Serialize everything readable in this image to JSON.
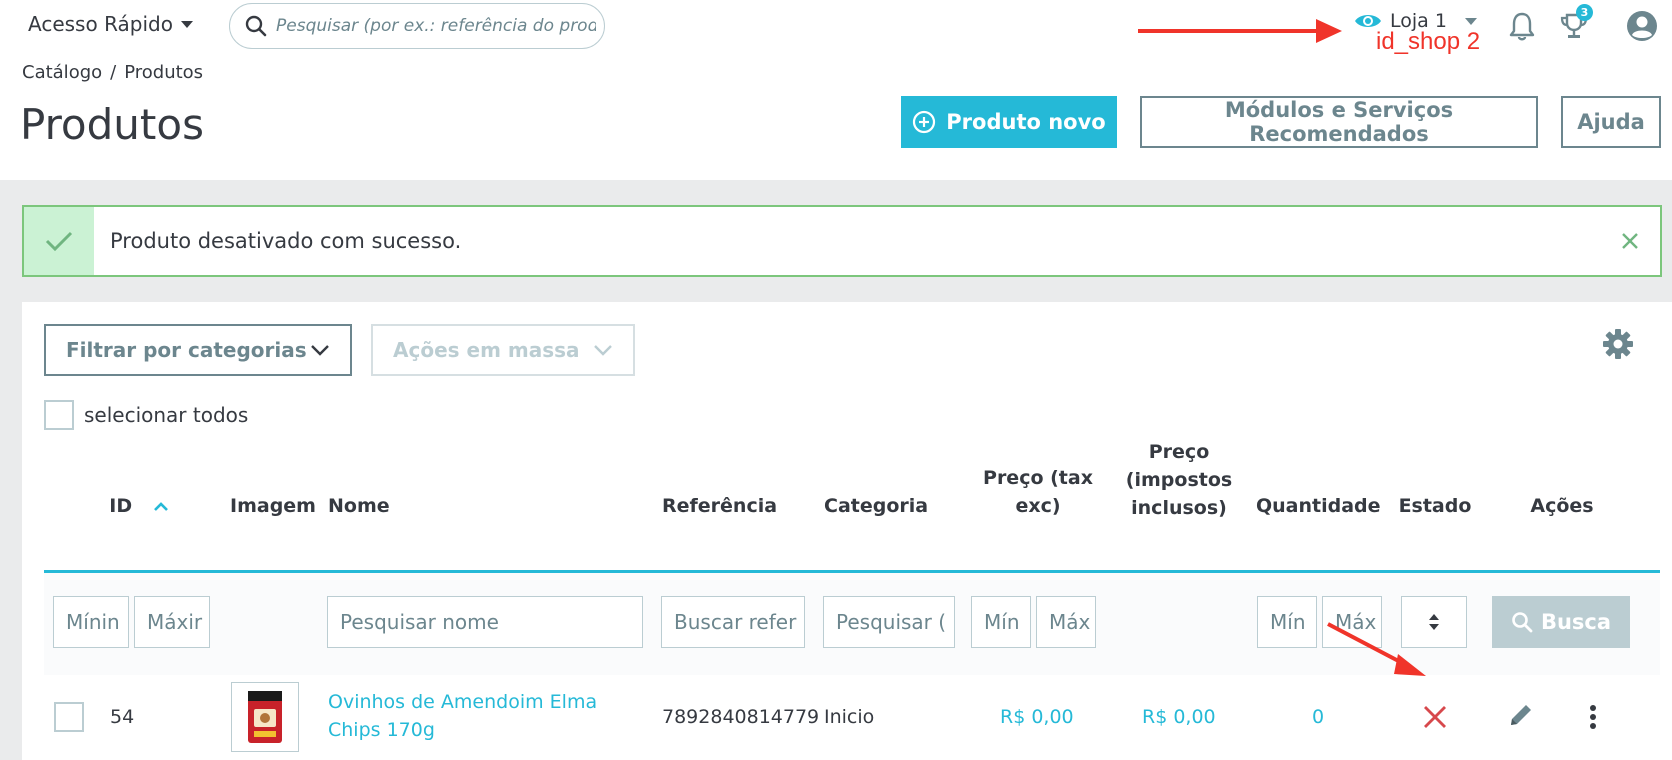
{
  "topbar": {
    "quick_access": "Acesso Rápido",
    "search_placeholder": "Pesquisar (por ex.: referência do produt",
    "shop_name": "Loja 1",
    "shop_annotation": "id_shop 2",
    "notifications_badge": "3"
  },
  "header": {
    "breadcrumb": [
      "Catálogo",
      "Produtos"
    ],
    "breadcrumb_sep": "/",
    "title": "Produtos",
    "btn_new": "Produto novo",
    "btn_modules": "Módulos e Serviços Recomendados",
    "btn_help": "Ajuda"
  },
  "alert": {
    "message": "Produto desativado com sucesso."
  },
  "toolbar": {
    "filter_categories": "Filtrar por categorias",
    "bulk_actions": "Ações em massa",
    "select_all": "selecionar todos"
  },
  "table": {
    "headers": {
      "id": "ID",
      "image": "Imagem",
      "name": "Nome",
      "reference": "Referência",
      "category": "Categoria",
      "price_tax_excl": "Preço (tax exc)",
      "price_tax_incl": "Preço (impostos inclusos)",
      "quantity": "Quantidade",
      "status": "Estado",
      "actions": "Ações"
    },
    "filters": {
      "id_min": "Mínin",
      "id_max": "Máxir",
      "name": "Pesquisar nome",
      "reference": "Buscar refer",
      "category": "Pesquisar (",
      "price_min": "Mín",
      "price_max": "Máx",
      "qty_min": "Mín",
      "qty_max": "Máx",
      "search_button": "Busca"
    },
    "rows": [
      {
        "id": "54",
        "name": "Ovinhos de Amendoim Elma Chips 170g",
        "reference": "7892840814779",
        "category": "Inicio",
        "price_tax_excl": "R$ 0,00",
        "price_tax_incl": "R$ 0,00",
        "quantity": "0",
        "status_icon": "close-icon"
      }
    ]
  },
  "colors": {
    "primary": "#25b9d7",
    "success_border": "#7cc67c",
    "danger": "#d7484c",
    "annotation": "#f0342a"
  }
}
